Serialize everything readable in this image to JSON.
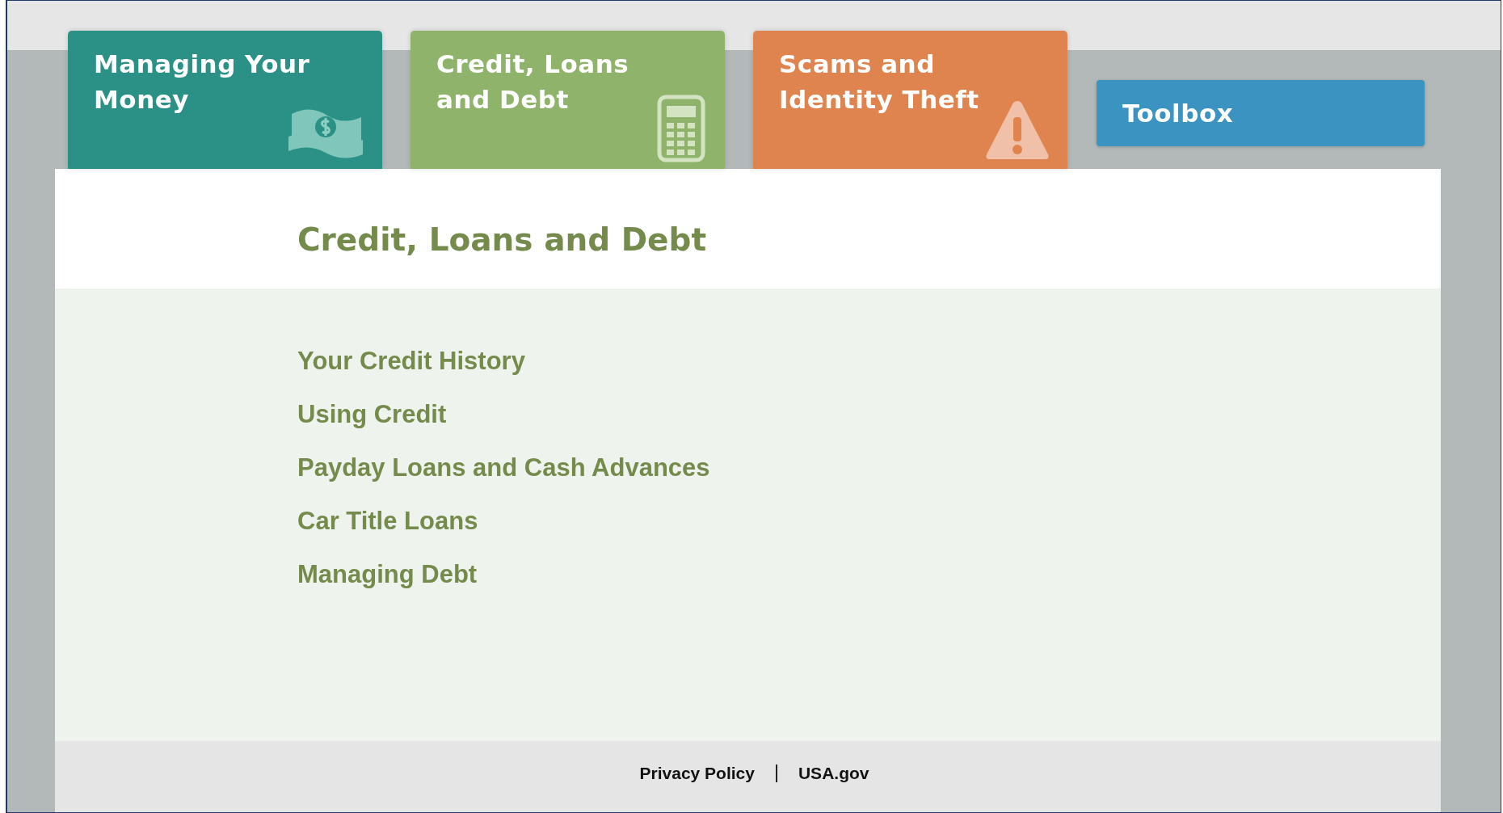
{
  "tabs": [
    {
      "label": "Managing Your\nMoney",
      "color": "#2b9187",
      "kind": "money"
    },
    {
      "label": "Credit, Loans\nand Debt",
      "color": "#8fb36b",
      "kind": "calculator"
    },
    {
      "label": "Scams and\nIdentity Theft",
      "color": "#e0844f",
      "kind": "warning"
    }
  ],
  "toolbox": {
    "label": "Toolbox",
    "color": "#3a93c0"
  },
  "heading": "Credit, Loans and Debt",
  "links": [
    "Your Credit History",
    "Using Credit",
    "Payday Loans and Cash Advances",
    "Car Title Loans",
    "Managing Debt"
  ],
  "footer_links": [
    "Privacy Policy",
    "USA.gov"
  ]
}
